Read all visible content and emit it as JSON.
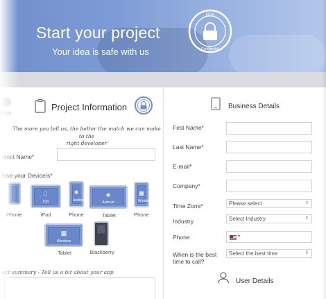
{
  "hero": {
    "title": "Start your project",
    "subtitle": "Your idea is safe with us",
    "badge": {
      "top_text": "NDA",
      "bottom_text": "Confidential"
    }
  },
  "left": {
    "step_label": "ct Us",
    "section_title": "Project Information",
    "intro_line1": "The more you tell us, the better the match we can make to the",
    "intro_line2": "right developer",
    "project_name_label": "oject Name*",
    "devices_label": "oose your Device/s*",
    "devices": [
      {
        "name": "iPhone",
        "glyph": ""
      },
      {
        "name": "iPad",
        "glyph": "iOS"
      },
      {
        "name": "Phone",
        "glyph": "Android"
      },
      {
        "name": "Tablet",
        "glyph": "Android"
      },
      {
        "name": "Phone",
        "glyph": "Windows"
      },
      {
        "name": "Tablet",
        "glyph": "Windows"
      },
      {
        "name": "Blackberry",
        "glyph": ""
      }
    ],
    "summary_label": "ect summary - Tell us a bit about your app"
  },
  "right": {
    "section_title": "Business Details",
    "first_name_label": "First Name*",
    "last_name_label": "Last Name*",
    "email_label": "E-mail*",
    "company_label": "Company*",
    "timezone_label": "Time Zone*",
    "timezone_value": "Please select",
    "industry_label": "Industry",
    "industry_value": "Select Industry",
    "phone_label": "Phone",
    "call_label_line1": "When is the best",
    "call_label_line2": "time to call?",
    "call_value": "Select the best time",
    "user_details_title": "User Details"
  },
  "colors": {
    "accent": "#7d9bd6",
    "device_fill": "#6987c9"
  }
}
